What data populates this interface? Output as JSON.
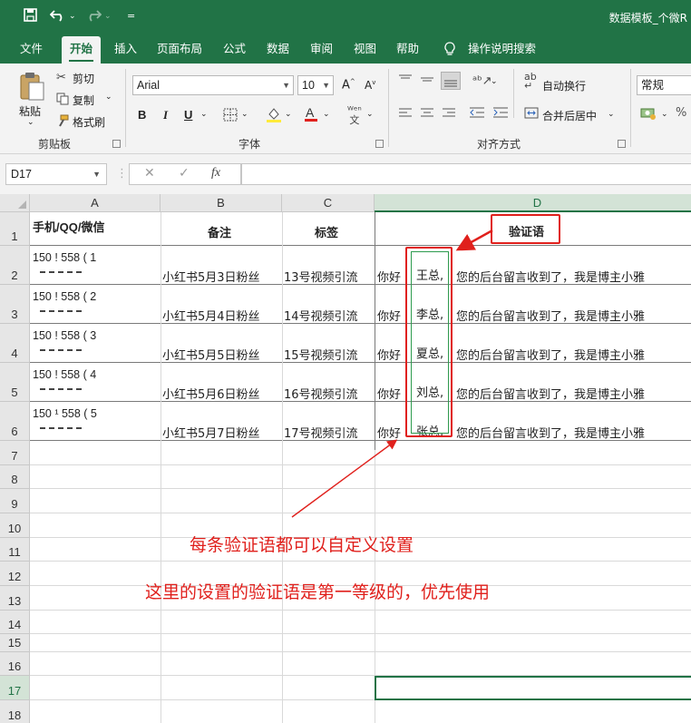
{
  "window": {
    "title": "数据模板_个微R"
  },
  "quick_access": {
    "save_icon": "save-icon",
    "undo_icon": "undo-icon",
    "redo_icon": "redo-icon",
    "customize": "="
  },
  "tabs": [
    "文件",
    "开始",
    "插入",
    "页面布局",
    "公式",
    "数据",
    "审阅",
    "视图",
    "帮助",
    "操作说明搜索"
  ],
  "active_tab": "开始",
  "ribbon": {
    "clipboard": {
      "paste": "粘贴",
      "cut": "剪切",
      "copy": "复制",
      "format_painter": "格式刷",
      "label": "剪贴板"
    },
    "font": {
      "name": "Arial",
      "size": "10",
      "bold": "B",
      "italic": "I",
      "underline": "U",
      "grow": "A",
      "shrink": "A",
      "label": "字体"
    },
    "alignment": {
      "wrap": "自动换行",
      "merge": "合并后居中",
      "label": "对齐方式"
    },
    "number": {
      "format": "常规"
    }
  },
  "formula_bar": {
    "name_box": "D17",
    "fx": "fx",
    "cancel": "✕",
    "enter": "✓",
    "value": ""
  },
  "columns": [
    "A",
    "B",
    "C",
    "D"
  ],
  "selected_column": "D",
  "rows": [
    "1",
    "2",
    "3",
    "4",
    "5",
    "6",
    "7",
    "8",
    "9",
    "10",
    "11",
    "12",
    "13",
    "14",
    "15",
    "16",
    "17",
    "18"
  ],
  "selected_row": "17",
  "headers": {
    "a": "手机/QQ/微信",
    "b": "备注",
    "c": "标签",
    "d": "验证语"
  },
  "data_rows": [
    {
      "phone": "150 ! 558 ( 1",
      "note": "小红书5月3日粉丝",
      "tag": "13号视频引流",
      "greet": "你好",
      "name": "王总,",
      "message": "您的后台留言收到了，我是博主小雅"
    },
    {
      "phone": "150 ! 558 ( 2",
      "note": "小红书5月4日粉丝",
      "tag": "14号视频引流",
      "greet": "你好",
      "name": "李总,",
      "message": "您的后台留言收到了，我是博主小雅"
    },
    {
      "phone": "150 ! 558 ( 3",
      "note": "小红书5月5日粉丝",
      "tag": "15号视频引流",
      "greet": "你好",
      "name": "夏总,",
      "message": "您的后台留言收到了，我是博主小雅"
    },
    {
      "phone": "150 ! 558 ( 4",
      "note": "小红书5月6日粉丝",
      "tag": "16号视频引流",
      "greet": "你好",
      "name": "刘总,",
      "message": "您的后台留言收到了，我是博主小雅"
    },
    {
      "phone": "150 ¹ 558 ( 5",
      "note": "小红书5月7日粉丝",
      "tag": "17号视频引流",
      "greet": "你好",
      "name": "张总,",
      "message": "您的后台留言收到了，我是博主小雅"
    }
  ],
  "annotations": {
    "note1": "每条验证语都可以自定义设置",
    "note2": "这里的设置的验证语是第一等级的，优先使用"
  },
  "colors": {
    "excel_green": "#217346",
    "annotation_red": "#e0201c",
    "highlight_green": "#2e9b4f"
  }
}
